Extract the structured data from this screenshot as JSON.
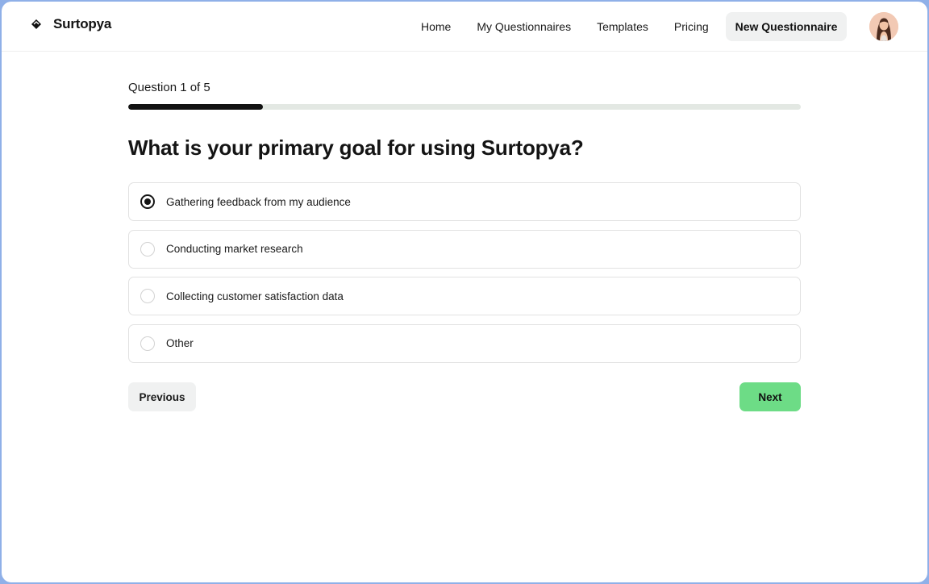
{
  "brand": {
    "name": "Surtopya",
    "icon": "diamond-logo-icon"
  },
  "nav": {
    "links": [
      "Home",
      "My Questionnaires",
      "Templates",
      "Pricing"
    ],
    "cta_label": "New Questionnaire",
    "avatar_icon": "user-avatar"
  },
  "progress": {
    "label": "Question 1 of 5",
    "fraction": 0.2
  },
  "question": {
    "title": "What is your primary goal for using Surtopya?",
    "options": [
      {
        "label": "Gathering feedback from my audience",
        "selected": true
      },
      {
        "label": "Conducting market research",
        "selected": false
      },
      {
        "label": "Collecting customer satisfaction data",
        "selected": false
      },
      {
        "label": "Other",
        "selected": false
      }
    ]
  },
  "actions": {
    "previous_label": "Previous",
    "next_label": "Next"
  },
  "colors": {
    "accent": "#6ddc86",
    "progress_fill": "#121212",
    "progress_track": "#e3e8e3"
  }
}
